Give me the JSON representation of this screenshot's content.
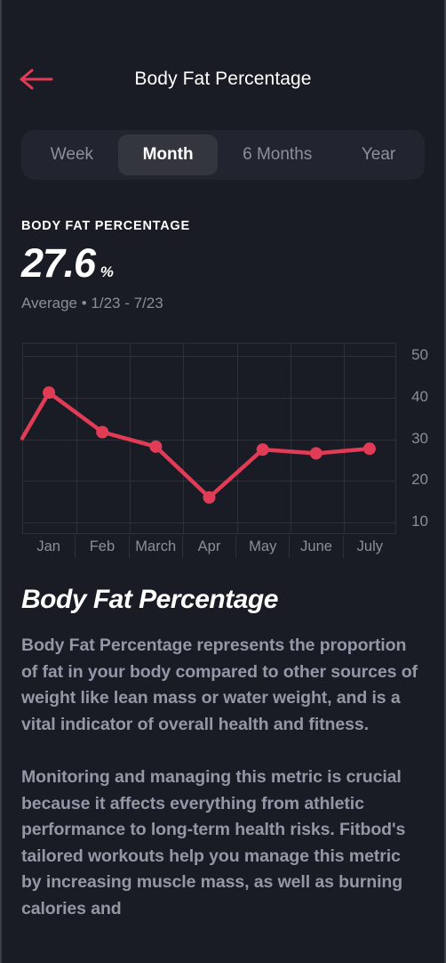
{
  "theme": {
    "background": "#1a1c25",
    "accent": "#e23b55",
    "text_primary": "#ffffff",
    "text_secondary": "#8b8d99",
    "body_text": "#9397a6",
    "segment_track": "#22242f",
    "segment_active": "#34363f",
    "grid": "#2e3038"
  },
  "navbar": {
    "back_icon": "arrow-left-icon",
    "title": "Body Fat Percentage"
  },
  "segmented_control": {
    "selected": "Month",
    "options": [
      {
        "label": "Week",
        "selected": false
      },
      {
        "label": "Month",
        "selected": true
      },
      {
        "label": "6 Months",
        "selected": false
      },
      {
        "label": "Year",
        "selected": false
      }
    ]
  },
  "summary": {
    "label": "BODY FAT PERCENTAGE",
    "value": "27.6",
    "unit": "%",
    "subtitle": "Average • 1/23 - 7/23"
  },
  "chart_data": {
    "type": "line",
    "title": "Body Fat Percentage",
    "xlabel": "",
    "ylabel": "",
    "categories": [
      "Jan",
      "Feb",
      "March",
      "Apr",
      "May",
      "June",
      "July"
    ],
    "values": [
      41,
      31.5,
      28,
      15.8,
      27.3,
      26.4,
      27.5
    ],
    "series": [
      {
        "name": "Body Fat Percentage",
        "values": [
          41,
          31.5,
          28,
          15.8,
          27.3,
          26.4,
          27.5
        ]
      }
    ],
    "y_ticks": [
      50,
      40,
      30,
      20,
      10
    ],
    "ylim": [
      7,
      53
    ],
    "grid": true,
    "legend": false,
    "line_color": "#e23b55",
    "point_color": "#e23b55",
    "leading_edge_value": 30
  },
  "article": {
    "title": "Body Fat Percentage",
    "paragraphs": [
      "Body Fat Percentage represents the proportion of fat in your body compared to other sources of weight like lean mass or water weight, and is a vital indicator of overall health and fitness.",
      "Monitoring and managing this metric is crucial because it affects everything from athletic performance to long-term health risks. Fitbod's tailored workouts help you manage this metric by increasing muscle mass, as well as burning calories and"
    ]
  }
}
